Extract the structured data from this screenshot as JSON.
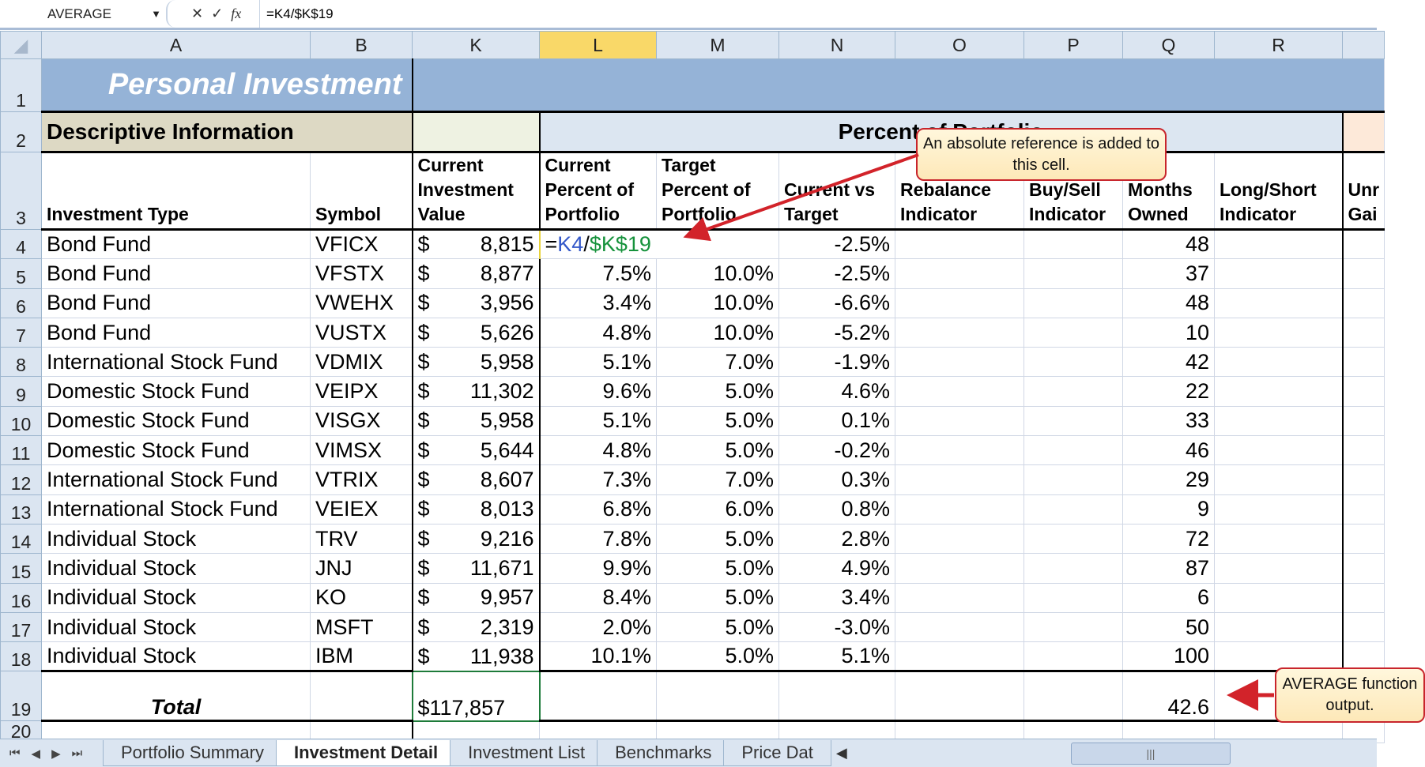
{
  "formula_bar": {
    "name_box": "AVERAGE",
    "formula": "=K4/$K$19",
    "cancel": "✕",
    "enter": "✓",
    "fx": "fx"
  },
  "columns": [
    "A",
    "B",
    "K",
    "L",
    "M",
    "N",
    "O",
    "P",
    "Q",
    "R",
    ""
  ],
  "selected_column": "L",
  "row_numbers": [
    "1",
    "2",
    "3",
    "4",
    "5",
    "6",
    "7",
    "8",
    "9",
    "10",
    "11",
    "12",
    "13",
    "14",
    "15",
    "16",
    "17",
    "18",
    "19",
    "20"
  ],
  "title": "Personal Investment",
  "sections": {
    "descriptive": "Descriptive Information",
    "percent": "Percent of Portfolio"
  },
  "headers": [
    "Investment Type",
    "Symbol",
    "Current Investment Value",
    "Current Percent of Portfolio",
    "Target Percent of Portfolio",
    "Current vs Target",
    "Rebalance Indicator",
    "Buy/Sell Indicator",
    "Months Owned",
    "Long/Short Indicator",
    "Unr Gai"
  ],
  "rows": [
    {
      "type": "Bond Fund",
      "symbol": "VFICX",
      "value": "8,815",
      "current": "",
      "target": "",
      "diff": "-2.5%",
      "months": "48"
    },
    {
      "type": "Bond Fund",
      "symbol": "VFSTX",
      "value": "8,877",
      "current": "7.5%",
      "target": "10.0%",
      "diff": "-2.5%",
      "months": "37"
    },
    {
      "type": "Bond Fund",
      "symbol": "VWEHX",
      "value": "3,956",
      "current": "3.4%",
      "target": "10.0%",
      "diff": "-6.6%",
      "months": "48"
    },
    {
      "type": "Bond Fund",
      "symbol": "VUSTX",
      "value": "5,626",
      "current": "4.8%",
      "target": "10.0%",
      "diff": "-5.2%",
      "months": "10"
    },
    {
      "type": "International Stock Fund",
      "symbol": "VDMIX",
      "value": "5,958",
      "current": "5.1%",
      "target": "7.0%",
      "diff": "-1.9%",
      "months": "42"
    },
    {
      "type": "Domestic Stock Fund",
      "symbol": "VEIPX",
      "value": "11,302",
      "current": "9.6%",
      "target": "5.0%",
      "diff": "4.6%",
      "months": "22"
    },
    {
      "type": "Domestic Stock Fund",
      "symbol": "VISGX",
      "value": "5,958",
      "current": "5.1%",
      "target": "5.0%",
      "diff": "0.1%",
      "months": "33"
    },
    {
      "type": "Domestic Stock Fund",
      "symbol": "VIMSX",
      "value": "5,644",
      "current": "4.8%",
      "target": "5.0%",
      "diff": "-0.2%",
      "months": "46"
    },
    {
      "type": "International Stock Fund",
      "symbol": "VTRIX",
      "value": "8,607",
      "current": "7.3%",
      "target": "7.0%",
      "diff": "0.3%",
      "months": "29"
    },
    {
      "type": "International Stock Fund",
      "symbol": "VEIEX",
      "value": "8,013",
      "current": "6.8%",
      "target": "6.0%",
      "diff": "0.8%",
      "months": "9"
    },
    {
      "type": "Individual Stock",
      "symbol": "TRV",
      "value": "9,216",
      "current": "7.8%",
      "target": "5.0%",
      "diff": "2.8%",
      "months": "72"
    },
    {
      "type": "Individual Stock",
      "symbol": "JNJ",
      "value": "11,671",
      "current": "9.9%",
      "target": "5.0%",
      "diff": "4.9%",
      "months": "87"
    },
    {
      "type": "Individual Stock",
      "symbol": "KO",
      "value": "9,957",
      "current": "8.4%",
      "target": "5.0%",
      "diff": "3.4%",
      "months": "6"
    },
    {
      "type": "Individual Stock",
      "symbol": "MSFT",
      "value": "2,319",
      "current": "2.0%",
      "target": "5.0%",
      "diff": "-3.0%",
      "months": "50"
    },
    {
      "type": "Individual Stock",
      "symbol": "IBM",
      "value": "11,938",
      "current": "10.1%",
      "target": "5.0%",
      "diff": "5.1%",
      "months": "100"
    }
  ],
  "currency": "$",
  "edit_cell": {
    "eq": "=",
    "ref1": "K4",
    "slash": "/",
    "ref2": "$K$19"
  },
  "total": {
    "label": "Total",
    "value": "$117,857",
    "months_avg": "42.6"
  },
  "sheet_tabs": [
    {
      "label": "Portfolio Summary",
      "active": false
    },
    {
      "label": "Investment Detail",
      "active": true
    },
    {
      "label": "Investment List",
      "active": false
    },
    {
      "label": "Benchmarks",
      "active": false
    },
    {
      "label": "Price Dat",
      "active": false
    }
  ],
  "callouts": {
    "absolute": "An absolute reference is added to this cell.",
    "average": "AVERAGE function output."
  },
  "colors": {
    "title_band": "#95b3d7",
    "callout_border": "#c8252c",
    "ref_blue": "#3458c9",
    "ref_green": "#16923c",
    "selected_header": "#f9d868"
  }
}
